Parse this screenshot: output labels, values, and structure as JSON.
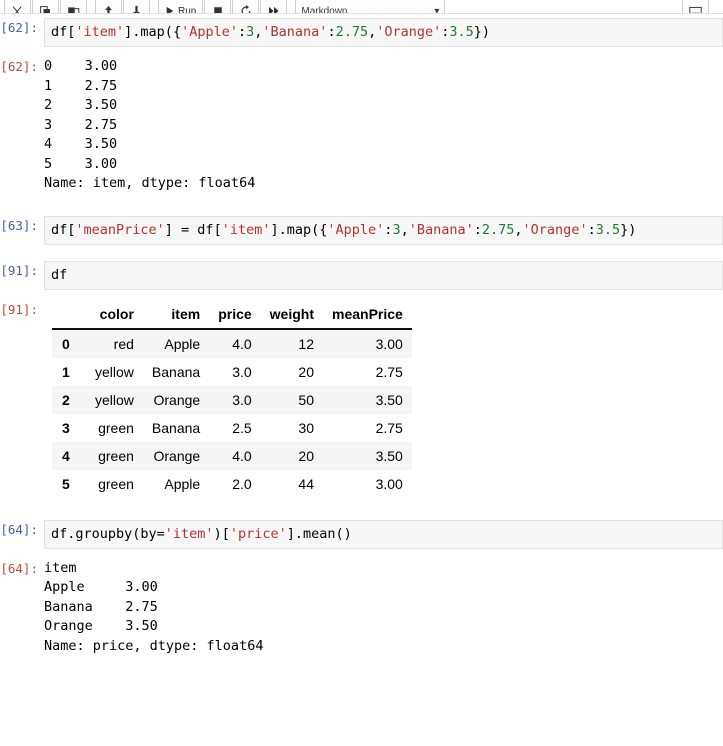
{
  "toolbar": {
    "buttons": [
      {
        "name": "cut-button",
        "icon": "scissors-icon",
        "label": "✂"
      },
      {
        "name": "copy-button",
        "icon": "copy-icon",
        "label": "❐"
      },
      {
        "name": "paste-button",
        "icon": "paste-icon",
        "label": "ὌB"
      },
      {
        "name": "move-cell-up-button",
        "icon": "arrow-up-icon",
        "label": "▲"
      },
      {
        "name": "move-cell-down-button",
        "icon": "arrow-down-icon",
        "label": "▼"
      }
    ],
    "run_label": "Run",
    "stop_label": "■",
    "restart_label": "↻",
    "restart_run_all_label": "»",
    "cell_type_value": "Markdown",
    "cell_type_caret": "▾",
    "open_in_browser_label": "⎘"
  },
  "cells": [
    {
      "id": "cell-62",
      "input_prompt": "[62]:",
      "output_prompt": "[62]:",
      "source_tokens": [
        {
          "t": "plain",
          "v": "df["
        },
        {
          "t": "str",
          "v": "'item'"
        },
        {
          "t": "plain",
          "v": "].map({"
        },
        {
          "t": "str",
          "v": "'Apple'"
        },
        {
          "t": "plain",
          "v": ":"
        },
        {
          "t": "num",
          "v": "3"
        },
        {
          "t": "plain",
          "v": ","
        },
        {
          "t": "str",
          "v": "'Banana'"
        },
        {
          "t": "plain",
          "v": ":"
        },
        {
          "t": "num",
          "v": "2.75"
        },
        {
          "t": "plain",
          "v": ","
        },
        {
          "t": "str",
          "v": "'Orange'"
        },
        {
          "t": "plain",
          "v": ":"
        },
        {
          "t": "num",
          "v": "3.5"
        },
        {
          "t": "plain",
          "v": "})"
        }
      ],
      "output_text": "0    3.00\n1    2.75\n2    3.50\n3    2.75\n4    3.50\n5    3.00\nName: item, dtype: float64"
    },
    {
      "id": "cell-63",
      "input_prompt": "[63]:",
      "source_tokens": [
        {
          "t": "plain",
          "v": "df["
        },
        {
          "t": "str",
          "v": "'meanPrice'"
        },
        {
          "t": "plain",
          "v": "] = df["
        },
        {
          "t": "str",
          "v": "'item'"
        },
        {
          "t": "plain",
          "v": "].map({"
        },
        {
          "t": "str",
          "v": "'Apple'"
        },
        {
          "t": "plain",
          "v": ":"
        },
        {
          "t": "num",
          "v": "3"
        },
        {
          "t": "plain",
          "v": ","
        },
        {
          "t": "str",
          "v": "'Banana'"
        },
        {
          "t": "plain",
          "v": ":"
        },
        {
          "t": "num",
          "v": "2.75"
        },
        {
          "t": "plain",
          "v": ","
        },
        {
          "t": "str",
          "v": "'Orange'"
        },
        {
          "t": "plain",
          "v": ":"
        },
        {
          "t": "num",
          "v": "3.5"
        },
        {
          "t": "plain",
          "v": "})"
        }
      ]
    },
    {
      "id": "cell-91",
      "input_prompt": "[91]:",
      "output_prompt": "[91]:",
      "source_tokens": [
        {
          "t": "plain",
          "v": "df"
        }
      ]
    },
    {
      "id": "cell-64",
      "input_prompt": "[64]:",
      "output_prompt": "[64]:",
      "source_tokens": [
        {
          "t": "plain",
          "v": "df.groupby(by="
        },
        {
          "t": "str",
          "v": "'item'"
        },
        {
          "t": "plain",
          "v": ")["
        },
        {
          "t": "str",
          "v": "'price'"
        },
        {
          "t": "plain",
          "v": "].mean()"
        }
      ],
      "output_text": "item\nApple     3.00\nBanana    2.75\nOrange    3.50\nName: price, dtype: float64"
    }
  ],
  "dataframe": {
    "index_header": "",
    "columns": [
      "color",
      "item",
      "price",
      "weight",
      "meanPrice"
    ],
    "index": [
      "0",
      "1",
      "2",
      "3",
      "4",
      "5"
    ],
    "rows": [
      [
        "red",
        "Apple",
        "4.0",
        "12",
        "3.00"
      ],
      [
        "yellow",
        "Banana",
        "3.0",
        "20",
        "2.75"
      ],
      [
        "yellow",
        "Orange",
        "3.0",
        "50",
        "3.50"
      ],
      [
        "green",
        "Banana",
        "2.5",
        "30",
        "2.75"
      ],
      [
        "green",
        "Orange",
        "4.0",
        "20",
        "3.50"
      ],
      [
        "green",
        "Apple",
        "2.0",
        "44",
        "3.00"
      ]
    ]
  },
  "colors": {
    "string_token": "#b5322d",
    "number_token": "#1d7d33",
    "input_prompt": "#4c5ba6",
    "output_prompt": "#c74a35",
    "cell_background": "#f7f7f7",
    "row_stripe": "#f5f5f5"
  }
}
